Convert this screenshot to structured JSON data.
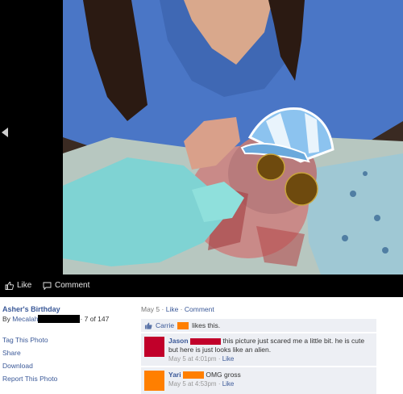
{
  "viewer": {
    "actions": {
      "like_label": "Like",
      "comment_label": "Comment"
    }
  },
  "album": {
    "title": "Asher's Birthday",
    "by_prefix": "By",
    "author": "Mecalah",
    "position": "· 7 of 147"
  },
  "photo_actions": [
    "Tag This Photo",
    "Share",
    "Download",
    "Report This Photo"
  ],
  "meta": {
    "date": "May 5",
    "sep": " · ",
    "like_label": "Like",
    "comment_label": "Comment"
  },
  "likes": {
    "name": "Carrie",
    "suffix": "likes this."
  },
  "comments": [
    {
      "name": "Jason",
      "text": "this picture just scared me a little bit. he is cute but here is just looks like an alien.",
      "time": "May 5 at 4:01pm",
      "like_label": "Like",
      "avatar_color": "#c1002a"
    },
    {
      "name": "Yari",
      "text": "OMG gross",
      "time": "May 5 at 4:53pm",
      "like_label": "Like",
      "avatar_color": "#ff7f00"
    }
  ],
  "colors": {
    "link": "#3b5998",
    "viewer_bg": "#000000",
    "comment_bg": "#edeff4"
  }
}
